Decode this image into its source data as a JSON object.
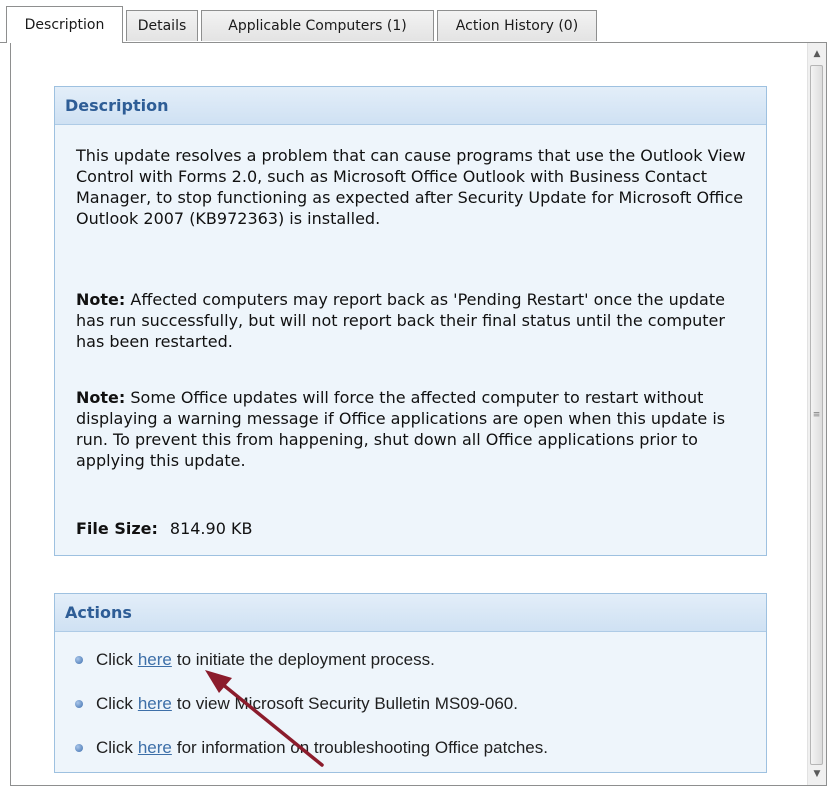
{
  "tabs": [
    {
      "label": "Description",
      "active": true
    },
    {
      "label": "Details",
      "active": false
    },
    {
      "label": "Applicable Computers (1)",
      "active": false
    },
    {
      "label": "Action History (0)",
      "active": false
    }
  ],
  "description_panel": {
    "title": "Description",
    "paragraph1": "This update resolves a problem that can cause programs that use the Outlook View Control with Forms 2.0, such as Microsoft Office Outlook with Business Contact Manager, to stop functioning as expected after Security Update for Microsoft Office Outlook 2007 (KB972363) is installed.",
    "note1_label": "Note:",
    "note1_text": "Affected computers may report back as 'Pending Restart' once the update has run successfully, but will not report back their final status until the computer has been restarted.",
    "note2_label": "Note:",
    "note2_text": "Some Office updates will force the affected computer to restart without displaying a warning message if Office applications are open when this update is run. To prevent this from happening, shut down all Office applications prior to applying this update.",
    "file_size_label": "File Size:",
    "file_size_value": "814.90 KB"
  },
  "actions_panel": {
    "title": "Actions",
    "items": [
      {
        "prefix": "Click",
        "link": "here",
        "suffix": "to initiate the deployment process."
      },
      {
        "prefix": "Click",
        "link": "here",
        "suffix": "to view Microsoft Security Bulletin MS09-060."
      },
      {
        "prefix": "Click",
        "link": "here",
        "suffix": "for information on troubleshooting Office patches."
      }
    ]
  },
  "colors": {
    "panel_header_text": "#2e5d96",
    "panel_border": "#9ec1e0",
    "panel_background": "#eef5fb",
    "link": "#3d6fa8",
    "annotation_arrow": "#8b1c2c"
  }
}
